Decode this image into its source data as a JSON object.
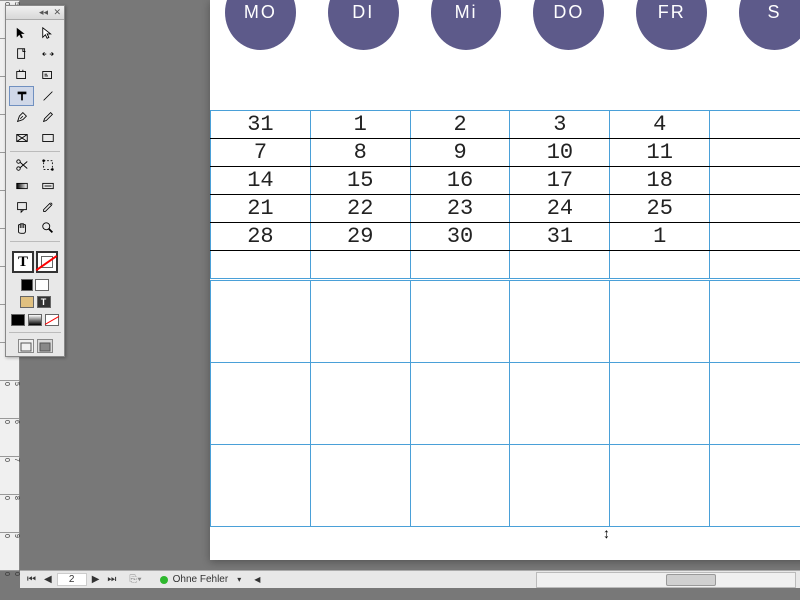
{
  "ruler": {
    "start": 150,
    "step": 10,
    "count": 16
  },
  "days": [
    "MO",
    "DI",
    "Mi",
    "DO",
    "FR",
    "S"
  ],
  "calendar_rows": [
    [
      "31",
      "1",
      "2",
      "3",
      "4",
      ""
    ],
    [
      "7",
      "8",
      "9",
      "10",
      "11",
      ""
    ],
    [
      "14",
      "15",
      "16",
      "17",
      "18",
      ""
    ],
    [
      "21",
      "22",
      "23",
      "24",
      "25",
      ""
    ],
    [
      "28",
      "29",
      "30",
      "31",
      "1",
      ""
    ]
  ],
  "status": {
    "page": "2",
    "error_label": "Ohne Fehler"
  },
  "tools": {
    "selection": "selection",
    "direct": "direct-selection",
    "page": "page",
    "gap": "gap",
    "content": "content-collector",
    "story": "story-editor",
    "type": "type",
    "line": "line",
    "pen": "pen",
    "pencil": "pencil",
    "frame": "rect-frame",
    "rect": "rectangle",
    "scissors": "scissors",
    "transform": "free-transform",
    "gradient_swatch": "gradient-swatch",
    "gradient": "gradient",
    "note": "note",
    "eyedropper": "eyedropper",
    "hand": "hand",
    "zoom": "zoom"
  },
  "colors": {
    "accent": "#5d5a8a",
    "grid": "#4aa0d8"
  }
}
